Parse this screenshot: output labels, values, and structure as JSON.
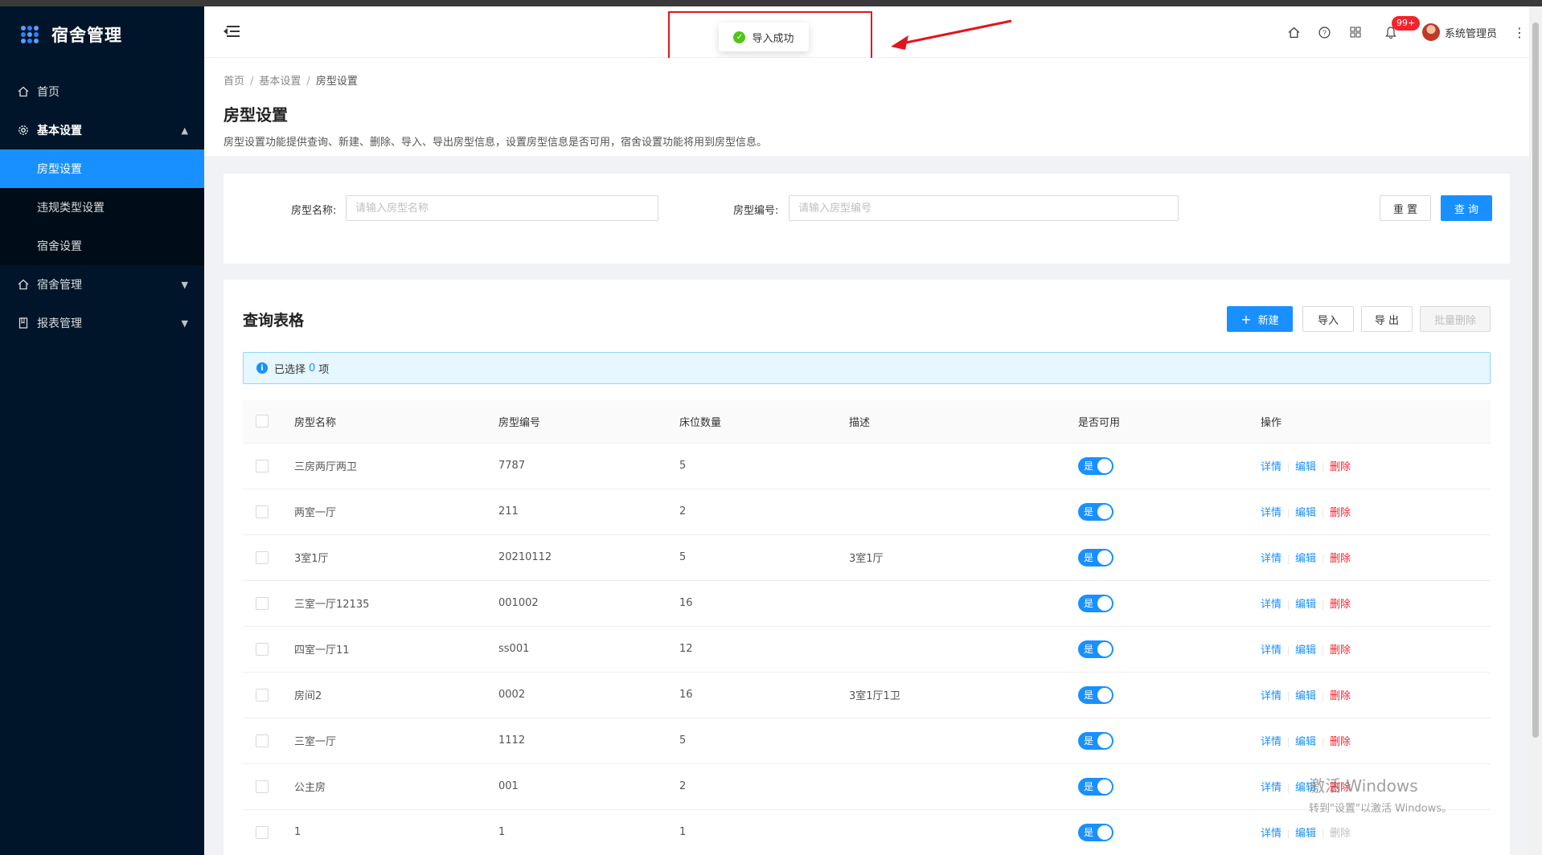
{
  "app": {
    "title": "宿舍管理"
  },
  "sidebar": {
    "items": [
      {
        "label": "首页",
        "icon": "home-icon"
      },
      {
        "label": "基本设置",
        "icon": "gear-icon",
        "open": true,
        "children": [
          {
            "label": "房型设置",
            "active": true
          },
          {
            "label": "违规类型设置"
          },
          {
            "label": "宿舍设置"
          }
        ]
      },
      {
        "label": "宿舍管理",
        "icon": "home-icon"
      },
      {
        "label": "报表管理",
        "icon": "report-icon"
      }
    ]
  },
  "header": {
    "notification_badge": "99+",
    "user_name": "系统管理员"
  },
  "toast": {
    "message": "导入成功"
  },
  "page": {
    "breadcrumb": [
      "首页",
      "基本设置",
      "房型设置"
    ],
    "title": "房型设置",
    "description": "房型设置功能提供查询、新建、删除、导入、导出房型信息，设置房型信息是否可用，宿舍设置功能将用到房型信息。"
  },
  "search": {
    "name_label": "房型名称:",
    "name_placeholder": "请输入房型名称",
    "code_label": "房型编号:",
    "code_placeholder": "请输入房型编号",
    "reset_label": "重 置",
    "query_label": "查 询"
  },
  "table_card": {
    "title": "查询表格",
    "new_label": "新建",
    "import_label": "导入",
    "export_label": "导 出",
    "batch_delete_label": "批量删除",
    "selected_prefix": "已选择",
    "selected_count": "0",
    "selected_suffix": "项",
    "columns": [
      "房型名称",
      "房型编号",
      "床位数量",
      "描述",
      "是否可用",
      "操作"
    ],
    "actions": {
      "detail": "详情",
      "edit": "编辑",
      "delete": "删除"
    },
    "rows": [
      {
        "name": "三房两厅两卫",
        "code": "7787",
        "beds": "5",
        "desc": "",
        "enabled": "是"
      },
      {
        "name": "两室一厅",
        "code": "211",
        "beds": "2",
        "desc": "",
        "enabled": "是"
      },
      {
        "name": "3室1厅",
        "code": "20210112",
        "beds": "5",
        "desc": "3室1厅",
        "enabled": "是"
      },
      {
        "name": "三室一厅12135",
        "code": "001002",
        "beds": "16",
        "desc": "",
        "enabled": "是"
      },
      {
        "name": "四室一厅11",
        "code": "ss001",
        "beds": "12",
        "desc": "",
        "enabled": "是"
      },
      {
        "name": "房间2",
        "code": "0002",
        "beds": "16",
        "desc": "3室1厅1卫",
        "enabled": "是"
      },
      {
        "name": "三室一厅",
        "code": "1112",
        "beds": "5",
        "desc": "",
        "enabled": "是"
      },
      {
        "name": "公主房",
        "code": "001",
        "beds": "2",
        "desc": "",
        "enabled": "是"
      },
      {
        "name": "1",
        "code": "1",
        "beds": "1",
        "desc": "",
        "enabled": "是"
      }
    ]
  },
  "watermark": {
    "line1": "激活 Windows",
    "line2": "转到\"设置\"以激活 Windows。"
  }
}
